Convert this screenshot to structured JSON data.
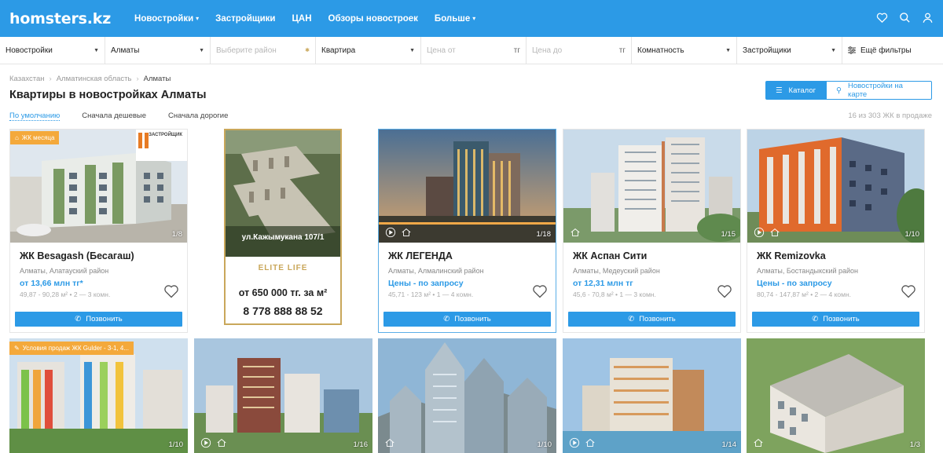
{
  "header": {
    "logo": "homsters.kz",
    "nav": [
      {
        "label": "Новостройки",
        "dropdown": true
      },
      {
        "label": "Застройщики",
        "dropdown": false
      },
      {
        "label": "ЦАН",
        "dropdown": false
      },
      {
        "label": "Обзоры новостроек",
        "dropdown": false
      },
      {
        "label": "Больше",
        "dropdown": true
      }
    ],
    "icons": [
      "heart-icon",
      "search-icon",
      "user-icon"
    ]
  },
  "filters": {
    "type": "Новостройки",
    "city": "Алматы",
    "district_placeholder": "Выберите район",
    "property": "Квартира",
    "price_from": "Цена от",
    "price_to": "Цена до",
    "currency": "тг",
    "rooms": "Комнатность",
    "developers": "Застройщики",
    "more": "Ещё фильтры"
  },
  "breadcrumbs": [
    "Казахстан",
    "Алматинская область",
    "Алматы"
  ],
  "page_title": "Квартиры в новостройках Алматы",
  "sort": {
    "default": "По умолчанию",
    "cheap": "Сначала дешевые",
    "expensive": "Сначала дорогие"
  },
  "count": "16 из 303 ЖК в продаже",
  "view": {
    "catalog": "Каталог",
    "map": "Новостройки на карте"
  },
  "call_label": "Позвонить",
  "cards": [
    {
      "name": "ЖК Besagash (Бесагаш)",
      "location": "Алматы, Алатауский район",
      "price": "от 13,66 млн тг*",
      "info": "49,87 - 90,28 м²  •  2 — 3 комн.",
      "counter": "1/8",
      "badge": "ЖК месяца",
      "brand": "ЗАСТРОЙЩИК"
    },
    {
      "name": "ЖК ЛЕГЕНДА",
      "location": "Алматы, Алмалинский район",
      "price": "Цены - по запросу",
      "info": "45,71 - 123 м²  •  1 — 4 комн.",
      "counter": "1/18"
    },
    {
      "name": "ЖК Аспан Сити",
      "location": "Алматы, Медеуский район",
      "price": "от 12,31 млн тг",
      "info": "45,6 - 70,8 м²  •  1 — 3 комн.",
      "counter": "1/15"
    },
    {
      "name": "ЖК Remizovka",
      "location": "Алматы, Бостандыкский район",
      "price": "Цены - по запросу",
      "info": "80,74 - 147,87 м²  •  2 — 4 комн.",
      "counter": "1/10"
    }
  ],
  "ad": {
    "address": "ул.Кажымукана 107/1",
    "brand": "ELITE LIFE",
    "price": "от 650 000 тг. за м²",
    "phone": "8 778 888 88 52"
  },
  "row2": [
    {
      "counter": "1/10",
      "badge": "Условия продаж ЖК Gulder - 3-1, 4..."
    },
    {
      "counter": "1/16"
    },
    {
      "counter": "1/10"
    },
    {
      "counter": "1/14"
    },
    {
      "counter": "1/3"
    }
  ],
  "colors": {
    "accent": "#2c9ae6",
    "badge": "#f4a93b",
    "ad_gold": "#c9a75a"
  }
}
